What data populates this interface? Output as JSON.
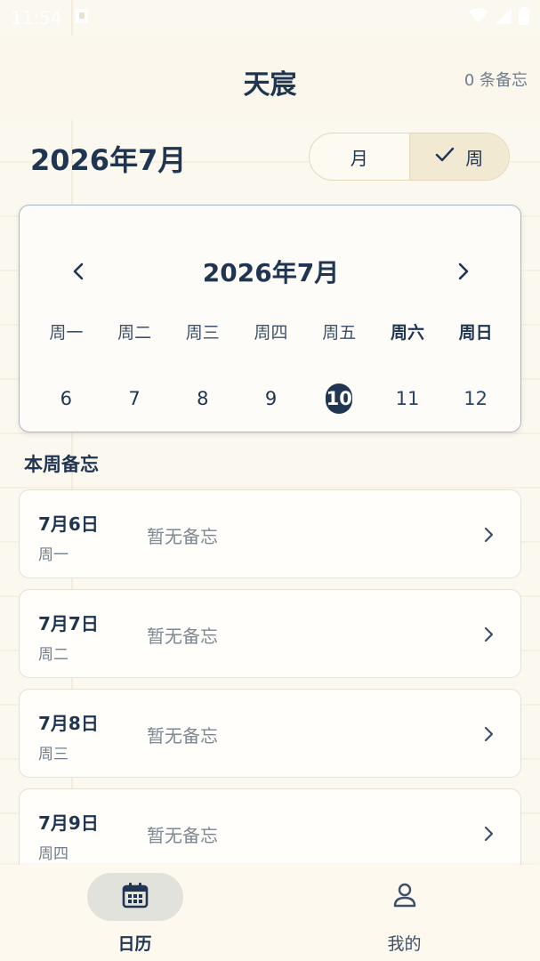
{
  "status_bar": {
    "time": "11:54"
  },
  "header": {
    "title": "天宸",
    "memo_count": "0 条备忘"
  },
  "month_heading": "2026年7月",
  "view_toggle": {
    "month_label": "月",
    "week_label": "周",
    "selected": "week"
  },
  "calendar": {
    "title": "2026年7月",
    "weekdays": [
      "周一",
      "周二",
      "周三",
      "周四",
      "周五",
      "周六",
      "周日"
    ],
    "dates": [
      "6",
      "7",
      "8",
      "9",
      "10",
      "11",
      "12"
    ],
    "today": "10"
  },
  "section_title": "本周备忘",
  "memos": [
    {
      "date": "7月6日",
      "weekday": "周一",
      "text": "暂无备忘"
    },
    {
      "date": "7月7日",
      "weekday": "周二",
      "text": "暂无备忘"
    },
    {
      "date": "7月8日",
      "weekday": "周三",
      "text": "暂无备忘"
    },
    {
      "date": "7月9日",
      "weekday": "周四",
      "text": "暂无备忘"
    }
  ],
  "bottom_nav": {
    "calendar_label": "日历",
    "profile_label": "我的"
  },
  "colors": {
    "primary": "#1f3552",
    "background": "#fbf8ef",
    "accent": "#f2e9d2"
  }
}
